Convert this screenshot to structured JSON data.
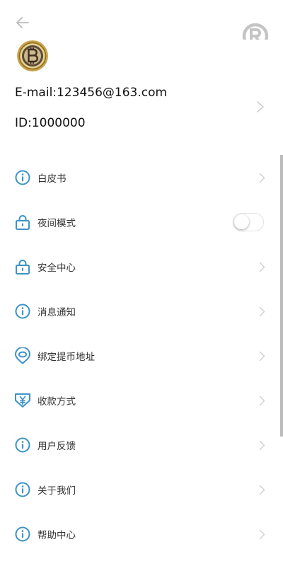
{
  "colors": {
    "accent": "#3d93c6",
    "chevron": "#cfcfcf",
    "text": "#333333",
    "back": "#bbbbbb",
    "logo": "#c4c4c4"
  },
  "header": {
    "back_icon": "arrow-left-icon",
    "logo_icon": "registered-logo-icon"
  },
  "profile": {
    "avatar_icon": "bitcoin-coin-avatar",
    "email": "E-mail:123456@163.com",
    "id": "ID:1000000"
  },
  "menu": {
    "items": [
      {
        "label": "白皮书",
        "icon": "info-icon",
        "right": "chevron"
      },
      {
        "label": "夜间模式",
        "icon": "lock-icon",
        "right": "toggle",
        "toggle_on": false
      },
      {
        "label": "安全中心",
        "icon": "lock-icon",
        "right": "chevron"
      },
      {
        "label": "消息通知",
        "icon": "info-icon",
        "right": "chevron"
      },
      {
        "label": "绑定提币地址",
        "icon": "location-pin-icon",
        "right": "chevron"
      },
      {
        "label": "收款方式",
        "icon": "yen-shield-icon",
        "right": "chevron"
      },
      {
        "label": "用户反馈",
        "icon": "info-icon",
        "right": "chevron"
      },
      {
        "label": "关于我们",
        "icon": "info-icon",
        "right": "chevron"
      },
      {
        "label": "帮助中心",
        "icon": "info-icon",
        "right": "chevron"
      }
    ]
  }
}
